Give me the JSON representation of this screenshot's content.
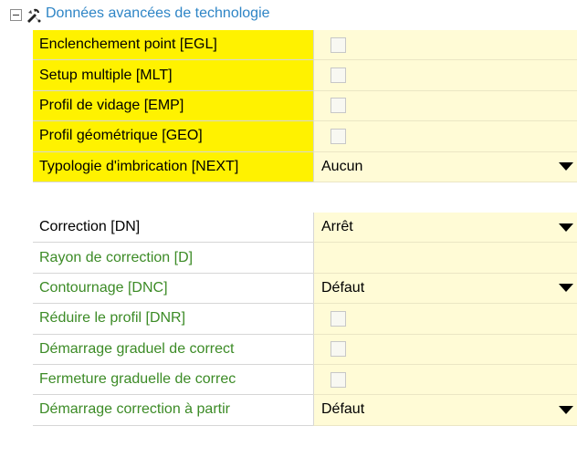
{
  "section": {
    "title": "Données avancées de technologie",
    "expander_icon": "collapse-icon",
    "icon": "tools-icon"
  },
  "colors": {
    "section_title": "#2e85c6",
    "highlight": "#fff200",
    "value_bg": "#fffbd6",
    "green_label": "#3c8b26"
  },
  "group1": [
    {
      "label": "Enclenchement point [EGL]",
      "type": "checkbox",
      "checked": false
    },
    {
      "label": "Setup multiple [MLT]",
      "type": "checkbox",
      "checked": false
    },
    {
      "label": "Profil de vidage [EMP]",
      "type": "checkbox",
      "checked": false
    },
    {
      "label": "Profil géométrique [GEO]",
      "type": "checkbox",
      "checked": false
    },
    {
      "label": "Typologie d'imbrication [NEXT]",
      "type": "dropdown",
      "value": "Aucun"
    }
  ],
  "group2": [
    {
      "label": "Correction [DN]",
      "type": "dropdown",
      "value": "Arrêt"
    },
    {
      "label": "Rayon de correction [D]",
      "type": "text",
      "value": ""
    },
    {
      "label": "Contournage [DNC]",
      "type": "dropdown",
      "value": "Défaut"
    },
    {
      "label": "Réduire le profil [DNR]",
      "type": "checkbox",
      "checked": false
    },
    {
      "label": "Démarrage graduel de correct",
      "type": "checkbox",
      "checked": false
    },
    {
      "label": "Fermeture graduelle de correc",
      "type": "checkbox",
      "checked": false
    },
    {
      "label": "Démarrage correction à partir",
      "type": "dropdown",
      "value": "Défaut"
    }
  ]
}
